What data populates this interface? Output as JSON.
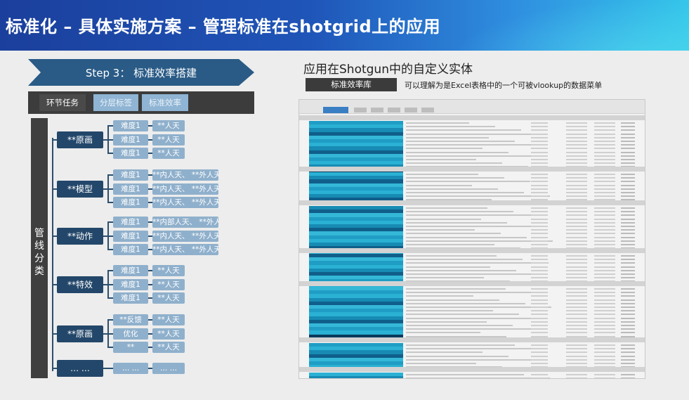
{
  "header": {
    "title": "标准化 – 具体实施方案 – 管理标准在shotgrid上的应用"
  },
  "step": {
    "label": "Step 3： 标准效率搭建"
  },
  "tabs": [
    {
      "label": "环节任务"
    },
    {
      "label": "分层标签"
    },
    {
      "label": "标准效率"
    }
  ],
  "sidebar": {
    "label": "管线分类"
  },
  "tree": [
    {
      "label": "**原画",
      "rows": [
        {
          "level": "难度1",
          "value": "**人天"
        },
        {
          "level": "难度1",
          "value": "**人天"
        },
        {
          "level": "难度1",
          "value": "**人天"
        }
      ]
    },
    {
      "label": "**模型",
      "rows": [
        {
          "level": "难度1",
          "value": "**内人天、 **外人天"
        },
        {
          "level": "难度1",
          "value": "**内人天、 **外人天"
        },
        {
          "level": "难度1",
          "value": "**内人天、 **外人天"
        }
      ]
    },
    {
      "label": "**动作",
      "rows": [
        {
          "level": "难度1",
          "value": "**内部人天、 **外人天"
        },
        {
          "level": "难度1",
          "value": "**内人天、 **外人天"
        },
        {
          "level": "难度1",
          "value": "**内人天、 **外人天"
        }
      ]
    },
    {
      "label": "**特效",
      "rows": [
        {
          "level": "难度1",
          "value": "**人天"
        },
        {
          "level": "难度1",
          "value": "**人天"
        },
        {
          "level": "难度1",
          "value": "**人天"
        }
      ]
    },
    {
      "label": "**原画",
      "rows": [
        {
          "level": "**反馈",
          "value": "**人天"
        },
        {
          "level": "优化",
          "value": "**人天"
        },
        {
          "level": "**",
          "value": "**人天"
        }
      ]
    },
    {
      "label": "…  …",
      "rows": [
        {
          "level": "…  …",
          "value": "…  …"
        }
      ]
    }
  ],
  "right": {
    "title": "应用在Shotgun中的自定义实体",
    "badge": "标准效率库",
    "desc": "可以理解为是Excel表格中的一个可被vlookup的数据菜单"
  },
  "colors": {
    "header_start": "#1b3f9c",
    "header_end": "#35c6ea",
    "category_bg": "#23476a",
    "pill_bg": "#8fb0cc",
    "dark_bar": "#3f3f3f",
    "sheet_highlight": "#2aa3c8"
  }
}
